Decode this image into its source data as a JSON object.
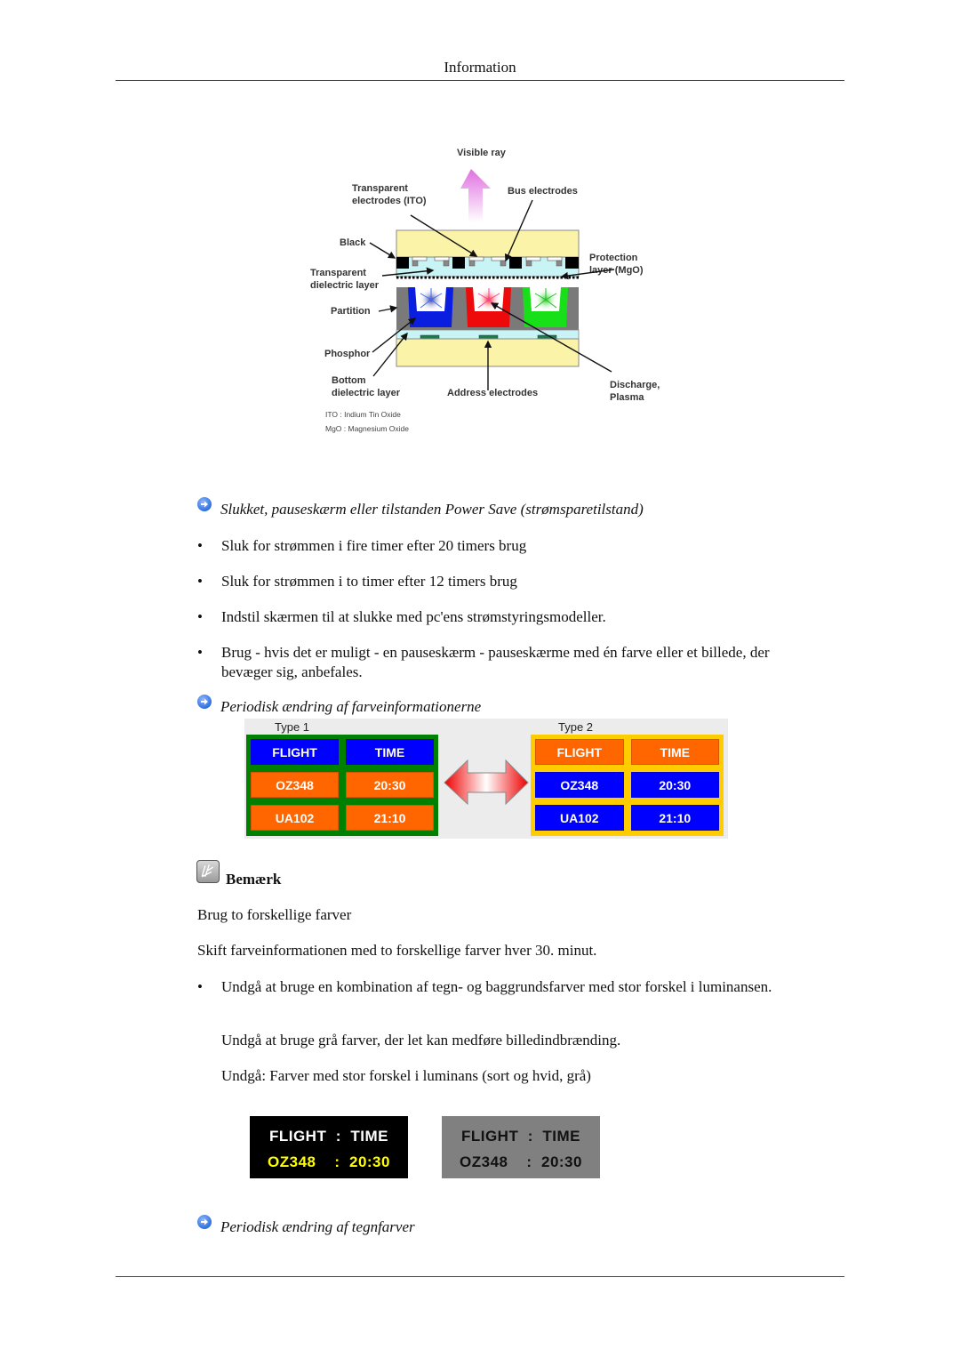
{
  "header": {
    "title": "Information"
  },
  "diagram": {
    "labels": {
      "visible_ray": "Visible ray",
      "transparent_electrodes_1": "Transparent",
      "transparent_electrodes_2": "electrodes  (ITO)",
      "bus_electrodes": "Bus electrodes",
      "black": "Black",
      "protection_1": "Protection",
      "protection_2": "layer (MgO)",
      "transparent_dielectric_1": "Transparent",
      "transparent_dielectric_2": "dielectric layer",
      "partition": "Partition",
      "phosphor": "Phosphor",
      "bottom_dielectric_1": "Bottom",
      "bottom_dielectric_2": "dielectric layer",
      "address_electrodes": "Address electrodes",
      "discharge_1": "Discharge,",
      "discharge_2": "Plasma",
      "note_ito": "ITO : Indium Tin Oxide",
      "note_mgo": "MgO : Magnesium Oxide"
    },
    "colors": {
      "glass": "#fbf4a8",
      "dielectric": "#c8f4f6",
      "partition": "#7a7a7a",
      "phosphor_blue": "#0a1ee0",
      "phosphor_red": "#ee0a0a",
      "phosphor_green": "#18e018",
      "address_electrode": "#1f7a4a"
    }
  },
  "section1": {
    "heading": "Slukket, pauseskærm eller tilstanden Power Save (strømsparetilstand)",
    "bullets": [
      "Sluk for strømmen i fire timer efter 20 timers brug",
      "Sluk for strømmen i to timer efter 12 timers brug",
      "Indstil skærmen til at slukke med pc'ens strømstyringsmodeller.",
      "Brug - hvis det er muligt - en pauseskærm - pauseskærme med én farve eller et billede, der bevæger sig, anbefales."
    ]
  },
  "section2": {
    "heading": "Periodisk ændring af farveinformationerne",
    "type1": {
      "label": "Type 1",
      "border_color": "#008000",
      "cells": [
        {
          "text": "FLIGHT",
          "bg": "#0000ff"
        },
        {
          "text": "TIME",
          "bg": "#0000ff"
        },
        {
          "text": "OZ348",
          "bg": "#ff6600"
        },
        {
          "text": "20:30",
          "bg": "#ff6600"
        },
        {
          "text": "UA102",
          "bg": "#ff6600"
        },
        {
          "text": "21:10",
          "bg": "#ff6600"
        }
      ]
    },
    "type2": {
      "label": "Type 2",
      "border_color": "#ffcc00",
      "cells": [
        {
          "text": "FLIGHT",
          "bg": "#ff6600"
        },
        {
          "text": "TIME",
          "bg": "#ff6600"
        },
        {
          "text": "OZ348",
          "bg": "#0000ff"
        },
        {
          "text": "20:30",
          "bg": "#0000ff"
        },
        {
          "text": "UA102",
          "bg": "#0000ff"
        },
        {
          "text": "21:10",
          "bg": "#0000ff"
        }
      ]
    }
  },
  "note": {
    "label": "Bemærk",
    "line1": "Brug to forskellige farver",
    "line2": "Skift farveinformationen med to forskellige farver hver 30. minut.",
    "bullet": "Undgå at bruge en kombination af tegn- og baggrundsfarver med stor forskel i luminansen.",
    "indent1": "Undgå at bruge grå farver, der let kan medføre billedindbrænding.",
    "indent2": "Undgå: Farver med stor forskel i luminans (sort og hvid, grå)"
  },
  "luminance_examples": [
    {
      "row1": "FLIGHT  :  TIME",
      "row2": "OZ348    :  20:30",
      "bg": "#000000",
      "row1_color": "#ffffff",
      "row2_color": "#ffff00"
    },
    {
      "row1": "FLIGHT  :  TIME",
      "row2": "OZ348    :  20:30",
      "bg": "#808080",
      "row1_color": "#111111",
      "row2_color": "#111111"
    }
  ],
  "section3": {
    "heading": "Periodisk ændring af tegnfarver"
  }
}
